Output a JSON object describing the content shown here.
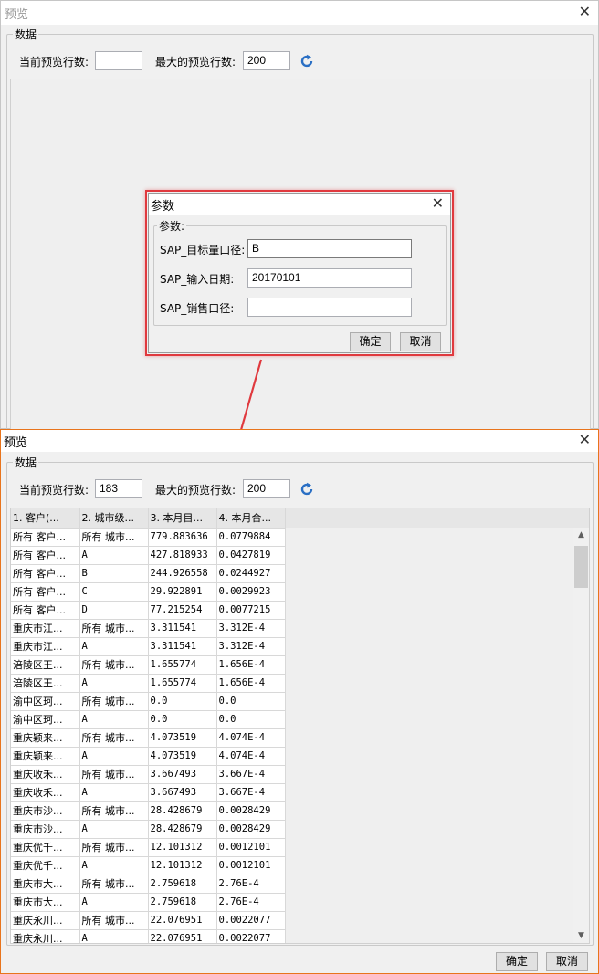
{
  "window_top": {
    "title": "预览",
    "group_label": "数据",
    "current_rows_label": "当前预览行数:",
    "current_rows_value": "",
    "max_rows_label": "最大的预览行数:",
    "max_rows_value": "200"
  },
  "param_dialog": {
    "title": "参数",
    "group_label": "参数:",
    "fields": [
      {
        "label": "SAP_目标量口径:",
        "value": "B"
      },
      {
        "label": "SAP_输入日期:",
        "value": "20170101"
      },
      {
        "label": "SAP_销售口径:",
        "value": ""
      }
    ],
    "ok_label": "确定",
    "cancel_label": "取消"
  },
  "window_bottom": {
    "title": "预览",
    "group_label": "数据",
    "current_rows_label": "当前预览行数:",
    "current_rows_value": "183",
    "max_rows_label": "最大的预览行数:",
    "max_rows_value": "200",
    "ok_label": "确定",
    "cancel_label": "取消",
    "table": {
      "columns": [
        "1. 客户(...",
        "2. 城市级...",
        "3. 本月目...",
        "4. 本月合..."
      ],
      "rows": [
        [
          "所有 客户...",
          "所有 城市...",
          "779.883636",
          "0.0779884"
        ],
        [
          "所有 客户...",
          "A",
          "427.818933",
          "0.0427819"
        ],
        [
          "所有 客户...",
          "B",
          "244.926558",
          "0.0244927"
        ],
        [
          "所有 客户...",
          "C",
          "29.922891",
          "0.0029923"
        ],
        [
          "所有 客户...",
          "D",
          "77.215254",
          "0.0077215"
        ],
        [
          "重庆市江...",
          "所有 城市...",
          "3.311541",
          "3.312E-4"
        ],
        [
          "重庆市江...",
          "A",
          "3.311541",
          "3.312E-4"
        ],
        [
          "涪陵区王...",
          "所有 城市...",
          "1.655774",
          "1.656E-4"
        ],
        [
          "涪陵区王...",
          "A",
          "1.655774",
          "1.656E-4"
        ],
        [
          "渝中区珂...",
          "所有 城市...",
          "0.0",
          "0.0"
        ],
        [
          "渝中区珂...",
          "A",
          "0.0",
          "0.0"
        ],
        [
          "重庆颖来...",
          "所有 城市...",
          "4.073519",
          "4.074E-4"
        ],
        [
          "重庆颖来...",
          "A",
          "4.073519",
          "4.074E-4"
        ],
        [
          "重庆收禾...",
          "所有 城市...",
          "3.667493",
          "3.667E-4"
        ],
        [
          "重庆收禾...",
          "A",
          "3.667493",
          "3.667E-4"
        ],
        [
          "重庆市沙...",
          "所有 城市...",
          "28.428679",
          "0.0028429"
        ],
        [
          "重庆市沙...",
          "A",
          "28.428679",
          "0.0028429"
        ],
        [
          "重庆优千...",
          "所有 城市...",
          "12.101312",
          "0.0012101"
        ],
        [
          "重庆优千...",
          "A",
          "12.101312",
          "0.0012101"
        ],
        [
          "重庆市大...",
          "所有 城市...",
          "2.759618",
          "2.76E-4"
        ],
        [
          "重庆市大...",
          "A",
          "2.759618",
          "2.76E-4"
        ],
        [
          "重庆永川...",
          "所有 城市...",
          "22.076951",
          "0.0022077"
        ],
        [
          "重庆永川...",
          "A",
          "22.076951",
          "0.0022077"
        ]
      ]
    }
  },
  "colors": {
    "highlight_red": "#e0393e",
    "window_border_orange": "#e8741c",
    "refresh_blue": "#2a6fc4"
  }
}
